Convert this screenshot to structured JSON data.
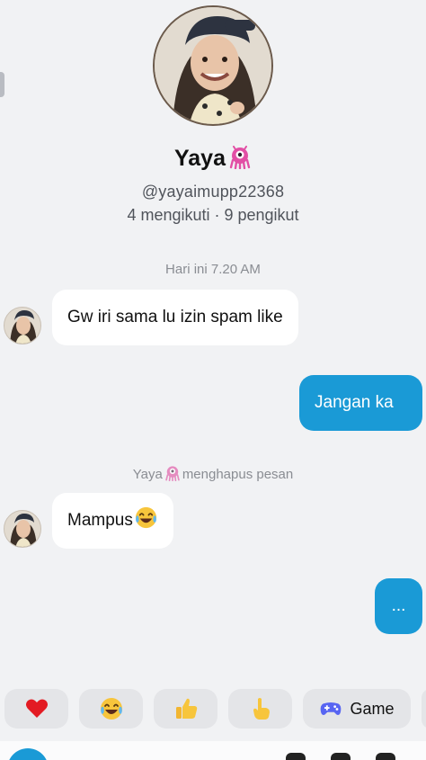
{
  "profile": {
    "name": "Yaya",
    "handle": "@yayaimupp22368",
    "stats": "4 mengikuti · 9 pengikut"
  },
  "messages": {
    "timestamp": "Hari ini 7.20 AM",
    "msg1": "Gw iri sama lu izin spam like",
    "reply1": "Jangan ka",
    "notice_name": "Yaya",
    "notice_text": "menghapus pesan",
    "msg2": "Mampus",
    "reply2": "..."
  },
  "quick_reactions": {
    "items": [
      "heart-emoji",
      "laughing-tears-emoji",
      "thumbs-up-emoji",
      "pointing-hand-emoji"
    ],
    "game_label": "Game"
  },
  "colors": {
    "outgoing_bubble": "#1a9ad6",
    "incoming_bubble": "#ffffff",
    "background": "#f1f2f4"
  }
}
